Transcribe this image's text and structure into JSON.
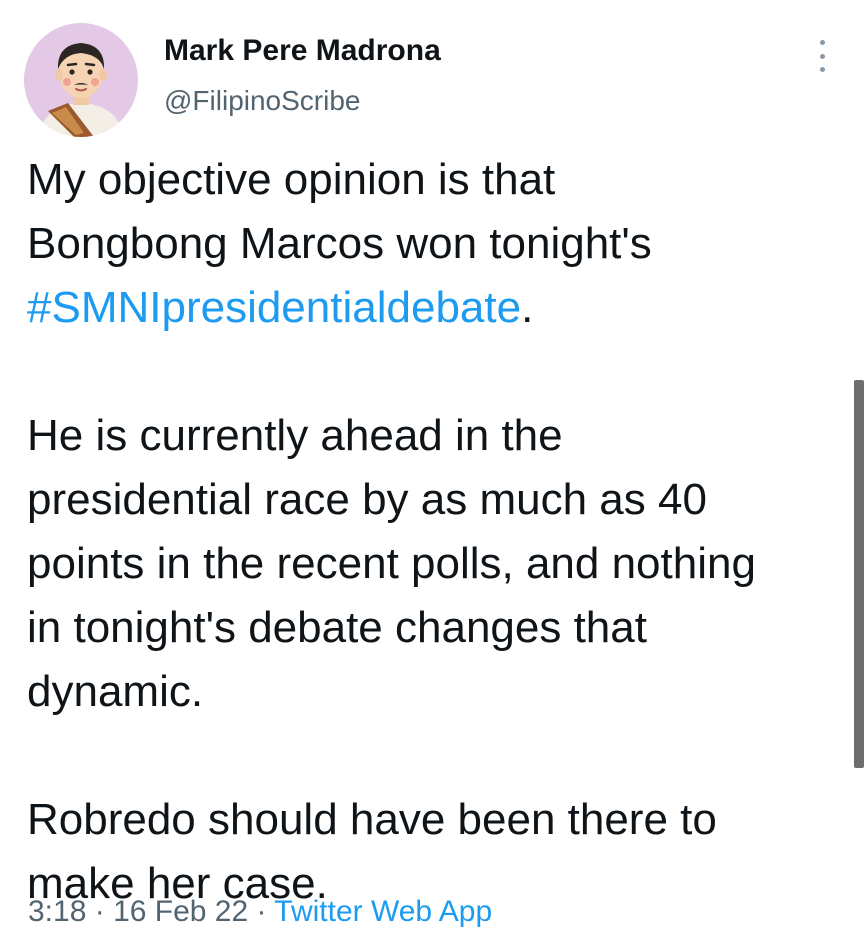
{
  "user": {
    "display_name": "Mark Pere Madrona",
    "handle": "@FilipinoScribe"
  },
  "tweet": {
    "line1": "My objective opinion is that",
    "line2": "Bongbong Marcos won tonight's",
    "hashtag": "#SMNIpresidentialdebate",
    "hashtag_tail": ".",
    "paragraph2_line1": "He is currently ahead in the",
    "paragraph2_line2": "presidential race by as much as 40",
    "paragraph2_line3": "points in the recent polls, and nothing",
    "paragraph2_line4": "in tonight's debate changes that",
    "paragraph2_line5": "dynamic.",
    "paragraph3_line1": "Robredo should have been there to",
    "paragraph3_line2": "make her case."
  },
  "meta": {
    "time": "3:18",
    "separator1": " · ",
    "date": "16 Feb 22",
    "separator2": " · ",
    "source": "Twitter Web App"
  },
  "colors": {
    "link": "#1d9bf0",
    "secondary_text": "#536471",
    "avatar_bg": "#e3c9e6"
  },
  "icons": {
    "more": "more-vertical-icon"
  }
}
